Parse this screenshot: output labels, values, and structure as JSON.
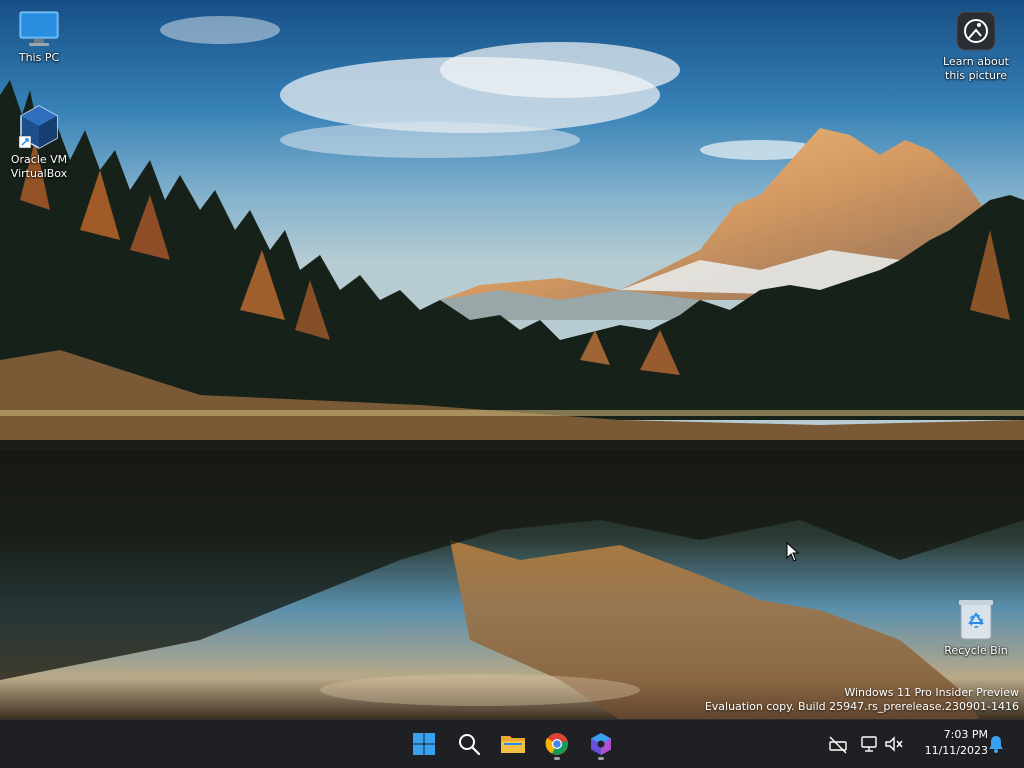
{
  "desktop": {
    "icons": [
      {
        "label": "This PC"
      },
      {
        "label": "Oracle VM VirtualBox"
      },
      {
        "label": "Learn about this picture"
      },
      {
        "label": "Recycle Bin"
      }
    ],
    "watermark": {
      "line1": "Windows 11 Pro Insider Preview",
      "line2": "Evaluation copy. Build 25947.rs_prerelease.230901-1416"
    }
  },
  "taskbar": {
    "apps": [
      {
        "icon": "windows-start-icon"
      },
      {
        "icon": "search-icon"
      },
      {
        "icon": "file-explorer-icon"
      },
      {
        "icon": "chrome-icon"
      },
      {
        "icon": "copilot-icon"
      }
    ],
    "tray": {
      "time": "7:03 PM",
      "date": "11/11/2023"
    }
  },
  "colors": {
    "taskbar_bg": "#1f2023",
    "accent_blue": "#1e90ff",
    "windows_blue": "#3aa0f0",
    "folder_yellow": "#f4c242"
  }
}
